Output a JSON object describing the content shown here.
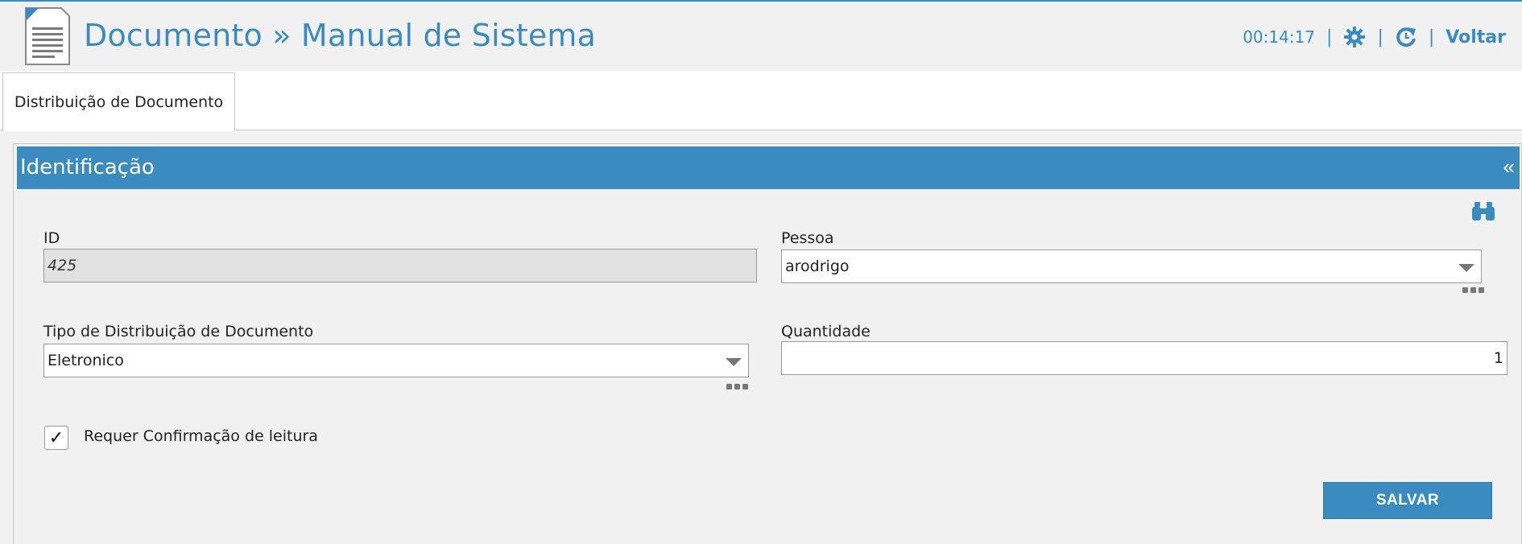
{
  "header": {
    "title": "Documento » Manual de Sistema",
    "clock": "00:14:17",
    "separator": "|",
    "back_label": "Voltar",
    "icons": [
      "document-icon",
      "gear-icon",
      "refresh-icon"
    ]
  },
  "tabs": [
    {
      "label": "Distribuição de Documento",
      "active": true
    }
  ],
  "section": {
    "title": "Identificação",
    "collapse_label": "«"
  },
  "form": {
    "id": {
      "label": "ID",
      "value": "425"
    },
    "pessoa": {
      "label": "Pessoa",
      "value": "arodrigo"
    },
    "tipo": {
      "label": "Tipo de Distribuição de Documento",
      "value": "Eletronico"
    },
    "quantidade": {
      "label": "Quantidade",
      "value": "1"
    },
    "confirmacao": {
      "label": "Requer Confirmação de leitura",
      "checked": true,
      "mark": "✓"
    }
  },
  "actions": {
    "save_label": "SALVAR"
  },
  "colors": {
    "accent": "#3a8bbf",
    "background": "#f1f1f1",
    "readonly_field": "#e1e1e1"
  }
}
